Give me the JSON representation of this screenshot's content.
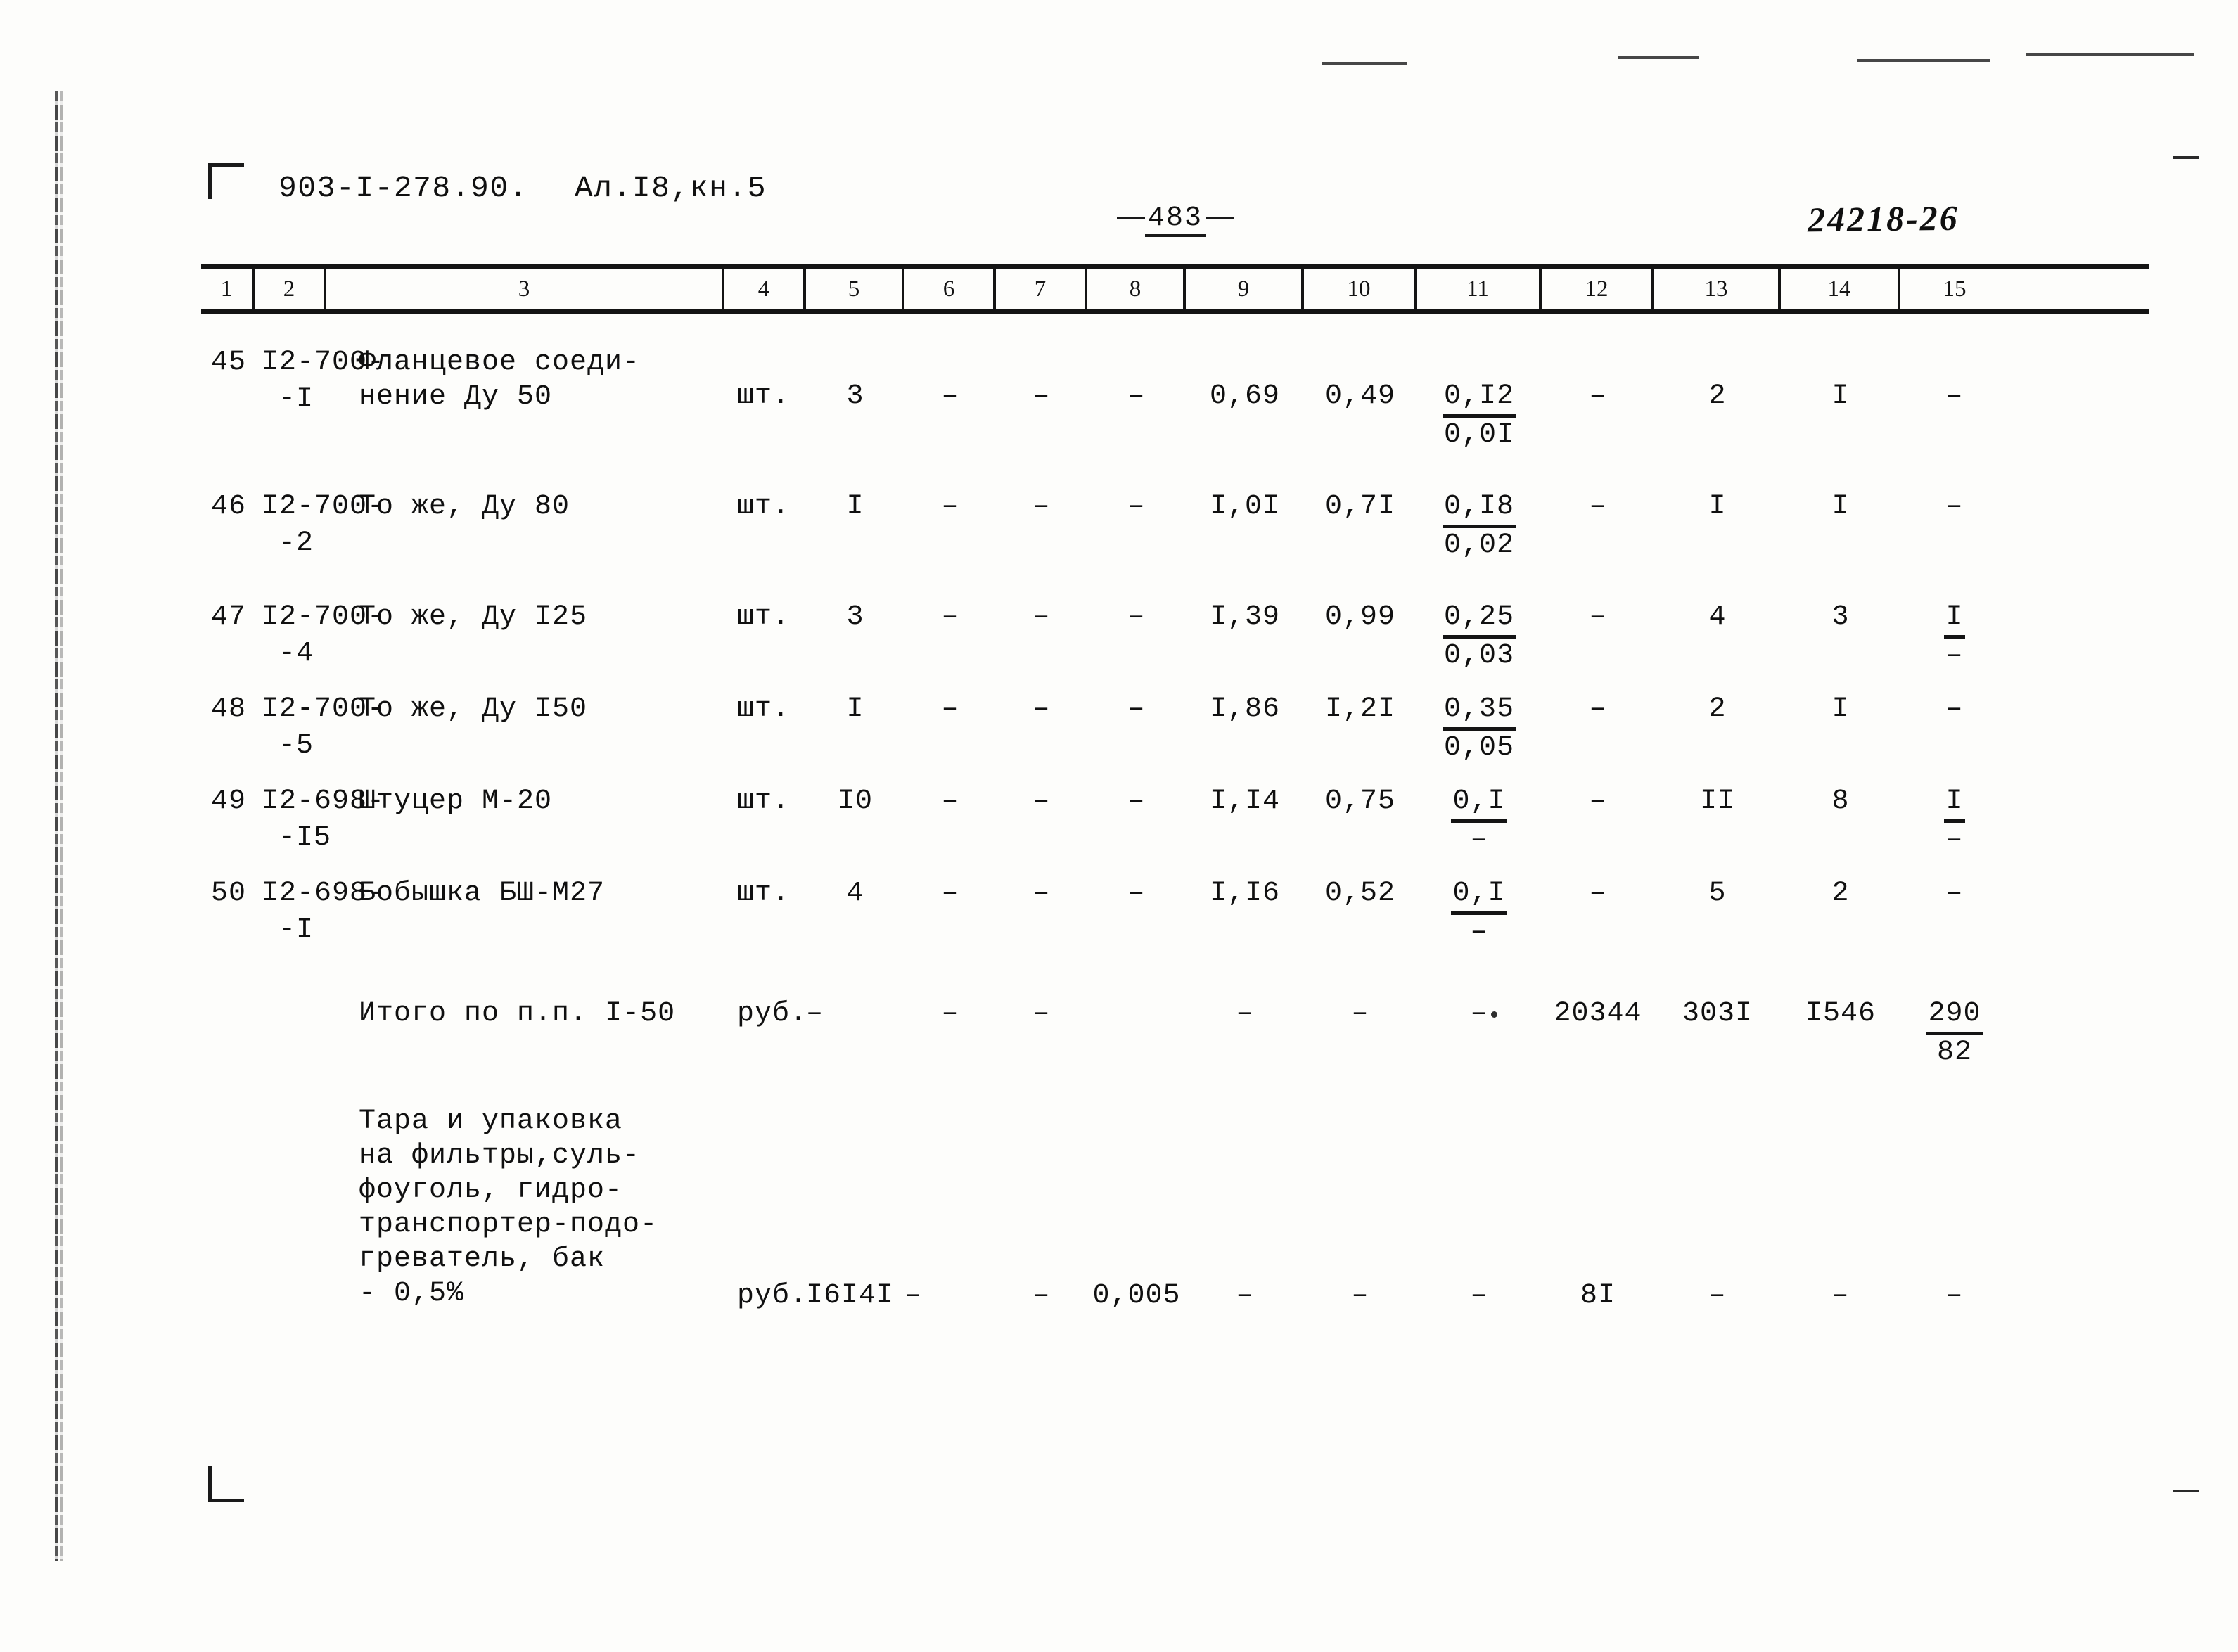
{
  "header": {
    "document_code": "903-I-278.90.",
    "album": "Ал.I8,кн.5",
    "page_number": "483",
    "archive_stamp": "24218-26"
  },
  "table": {
    "column_headers": [
      "1",
      "2",
      "3",
      "4",
      "5",
      "6",
      "7",
      "8",
      "9",
      "10",
      "11",
      "12",
      "13",
      "14",
      "15"
    ],
    "rows": [
      {
        "num": "45",
        "code_line1": "I2-700-",
        "code_line2": "-I",
        "name": "Фланцевое соеди-\nнение Ду 50",
        "unit": "шт.",
        "c5": "3",
        "c6": "–",
        "c7": "–",
        "c8": "–",
        "c9": "0,69",
        "c10": "0,49",
        "c11_top": "0,I2",
        "c11_bot": "0,0I",
        "c12": "–",
        "c13": "2",
        "c14": "I",
        "c15": "–"
      },
      {
        "num": "46",
        "code_line1": "I2-700-",
        "code_line2": "-2",
        "name": "То же, Ду 80",
        "unit": "шт.",
        "c5": "I",
        "c6": "–",
        "c7": "–",
        "c8": "–",
        "c9": "I,0I",
        "c10": "0,7I",
        "c11_top": "0,I8",
        "c11_bot": "0,02",
        "c12": "–",
        "c13": "I",
        "c14": "I",
        "c15": "–"
      },
      {
        "num": "47",
        "code_line1": "I2-700-",
        "code_line2": "-4",
        "name": "То же, Ду I25",
        "unit": "шт.",
        "c5": "3",
        "c6": "–",
        "c7": "–",
        "c8": "–",
        "c9": "I,39",
        "c10": "0,99",
        "c11_top": "0,25",
        "c11_bot": "0,03",
        "c12": "–",
        "c13": "4",
        "c14": "3",
        "c15_top": "I",
        "c15_bot": "–"
      },
      {
        "num": "48",
        "code_line1": "I2-700-",
        "code_line2": "-5",
        "name": "То же, Ду I50",
        "unit": "шт.",
        "c5": "I",
        "c6": "–",
        "c7": "–",
        "c8": "–",
        "c9": "I,86",
        "c10": "I,2I",
        "c11_top": "0,35",
        "c11_bot": "0,05",
        "c12": "–",
        "c13": "2",
        "c14": "I",
        "c15": "–"
      },
      {
        "num": "49",
        "code_line1": "I2-698-",
        "code_line2": "-I5",
        "name": "Штуцер М-20",
        "unit": "шт.",
        "c5": "I0",
        "c6": "–",
        "c7": "–",
        "c8": "–",
        "c9": "I,I4",
        "c10": "0,75",
        "c11_top": "0,I",
        "c11_bot": "–",
        "c12": "–",
        "c13": "II",
        "c14": "8",
        "c15_top": "I",
        "c15_bot": "–"
      },
      {
        "num": "50",
        "code_line1": "I2-698-",
        "code_line2": "-I",
        "name": "Бобышка БШ-М27",
        "unit": "шт.",
        "c5": "4",
        "c6": "–",
        "c7": "–",
        "c8": "–",
        "c9": "I,I6",
        "c10": "0,52",
        "c11_top": "0,I",
        "c11_bot": "–",
        "c12": "–",
        "c13": "5",
        "c14": "2",
        "c15": "–"
      }
    ],
    "total_row": {
      "num": "",
      "code_line1": "",
      "code_line2": "",
      "name": "Итого по п.п. I-50",
      "unit": "руб.",
      "c5": "–",
      "c6": "–",
      "c7": "–",
      "c8": "",
      "c9": "–",
      "c10": "–",
      "c11": "–",
      "c12": "20344",
      "c13": "303I",
      "c14": "I546",
      "c15_top": "290",
      "c15_bot": "82"
    },
    "packaging_row": {
      "name": "Тара и упаковка\nна фильтры,суль-\nфоуголь, гидро-\nтранспортер-подо-\nгреватель, бак\n- 0,5%",
      "unit": "руб.",
      "c5": "I6I4I",
      "c6": "–",
      "c7": "–",
      "c8": "0,005",
      "c9": "–",
      "c10": "–",
      "c11": "–",
      "c12": "8I",
      "c13": "–",
      "c14": "–",
      "c15": "–"
    }
  }
}
